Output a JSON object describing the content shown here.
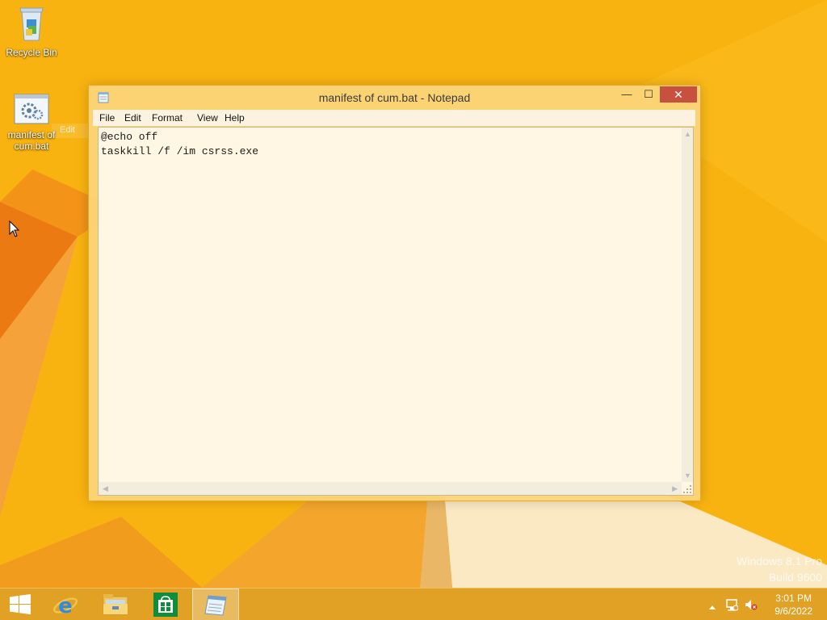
{
  "desktop": {
    "icons": [
      {
        "label": "Recycle Bin",
        "icon": "recycle-bin-icon"
      },
      {
        "label": "manifest of cum.bat",
        "icon": "batch-file-icon"
      }
    ],
    "drag_ghost_label": "Edit",
    "watermark": {
      "line1": "Windows 8.1 Pro",
      "line2": "Build 9600"
    }
  },
  "window": {
    "title": "manifest of cum.bat - Notepad",
    "controls": {
      "minimize": "—",
      "maximize": "☐",
      "close": "✕"
    },
    "menu": [
      "File",
      "Edit",
      "Format",
      "View",
      "Help"
    ],
    "content": "@echo off\ntaskkill /f /im csrss.exe"
  },
  "taskbar": {
    "pinned": [
      {
        "name": "start",
        "icon": "windows-logo-icon"
      },
      {
        "name": "internet-explorer",
        "icon": "ie-icon"
      },
      {
        "name": "file-explorer",
        "icon": "folder-icon"
      },
      {
        "name": "store",
        "icon": "store-icon"
      },
      {
        "name": "notepad",
        "icon": "notepad-icon",
        "active": true
      }
    ],
    "tray": {
      "time": "3:01 PM",
      "date": "9/6/2022"
    }
  },
  "colors": {
    "wallpaper": "#f9b310",
    "wallpaper_dark": "#f08a0c",
    "close_button": "#c7503f",
    "window_frame": "#fcd478"
  }
}
